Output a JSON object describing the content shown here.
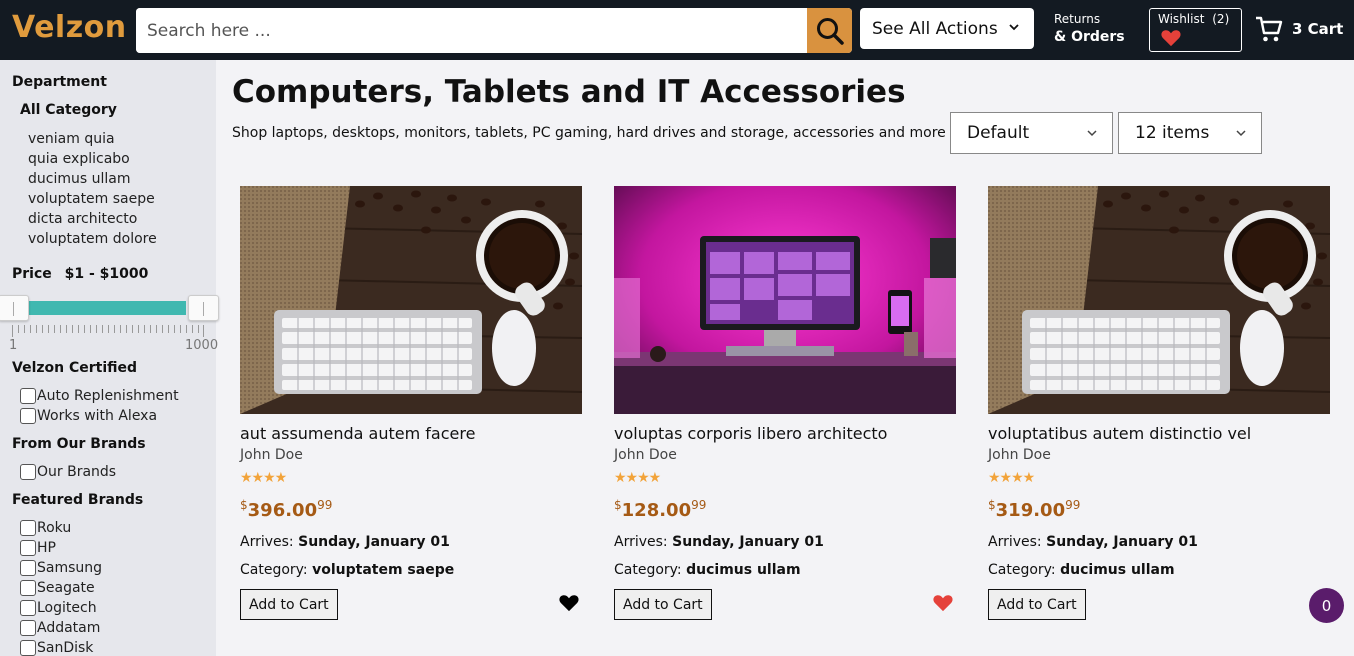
{
  "header": {
    "logo": "Velzon",
    "search_placeholder": "Search here ...",
    "actions_label": "See All Actions",
    "returns_small": "Returns",
    "returns_big": "& Orders",
    "wishlist_label": "Wishlist",
    "wishlist_count": "(2)",
    "cart_label": "3 Cart"
  },
  "sidebar": {
    "department_title": "Department",
    "all_category": "All Category",
    "categories": [
      "veniam quia",
      "quia explicabo",
      "ducimus ullam",
      "voluptatem saepe",
      "dicta architecto",
      "voluptatem dolore"
    ],
    "price_title": "Price",
    "price_range": "$1 - $1000",
    "price_min_label": "1",
    "price_max_label": "1000",
    "certified_title": "Velzon Certified",
    "certified_options": [
      "Auto Replenishment",
      "Works with Alexa"
    ],
    "brands_title": "From Our Brands",
    "brands_options": [
      "Our Brands"
    ],
    "featured_title": "Featured Brands",
    "featured_options": [
      "Roku",
      "HP",
      "Samsung",
      "Seagate",
      "Logitech",
      "Addatam",
      "SanDisk"
    ]
  },
  "main": {
    "title": "Computers, Tablets and IT Accessories",
    "subtitle": "Shop laptops, desktops, monitors, tablets, PC gaming, hard drives and storage, accessories and more",
    "sort_value": "Default",
    "count_value": "12 items"
  },
  "products": [
    {
      "name": "aut assumenda autem facere",
      "author": "John Doe",
      "rating": "★★★★",
      "currency": "$",
      "price_whole": "396.00",
      "price_frac": "99",
      "arrives_label": "Arrives:",
      "arrives": "Sunday, January 01",
      "category_label": "Category:",
      "category": "voluptatem saepe",
      "button": "Add to Cart",
      "wish_color": "#000000",
      "image": "keyboard-coffee"
    },
    {
      "name": "voluptas corporis libero architecto",
      "author": "John Doe",
      "rating": "★★★★",
      "currency": "$",
      "price_whole": "128.00",
      "price_frac": "99",
      "arrives_label": "Arrives:",
      "arrives": "Sunday, January 01",
      "category_label": "Category:",
      "category": "ducimus ullam",
      "button": "Add to Cart",
      "wish_color": "#e5413a",
      "image": "pink-desktop"
    },
    {
      "name": "voluptatibus autem distinctio vel",
      "author": "John Doe",
      "rating": "★★★★",
      "currency": "$",
      "price_whole": "319.00",
      "price_frac": "99",
      "arrives_label": "Arrives:",
      "arrives": "Sunday, January 01",
      "category_label": "Category:",
      "category": "ducimus ullam",
      "button": "Add to Cart",
      "wish_color": "#000000",
      "image": "keyboard-coffee"
    }
  ],
  "chat_badge": "0",
  "colors": {
    "header_bg": "#131a22",
    "brand": "#e09b3d",
    "search_button": "#d9923f",
    "slider": "#40b8b0",
    "price": "#a55a15",
    "star": "#f2a33a",
    "chat": "#5a1c6b"
  },
  "icons": {
    "search": "search-icon",
    "cart": "cart-icon",
    "wishlist": "heart-icon",
    "dropdown": "chevron-down-icon"
  }
}
